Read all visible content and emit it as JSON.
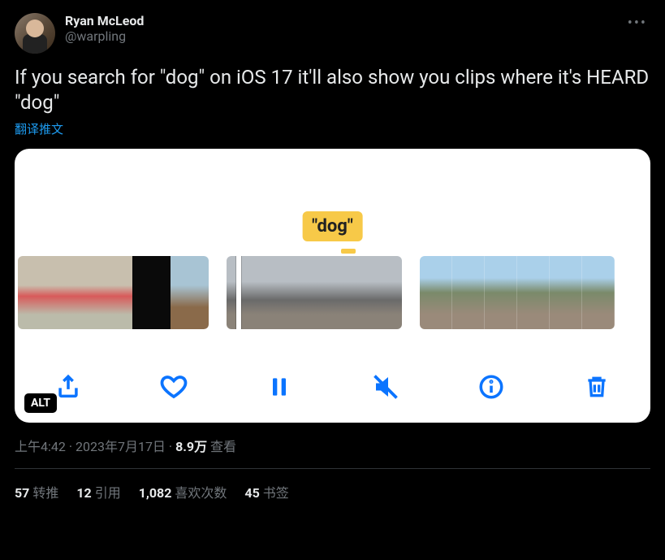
{
  "author": {
    "display_name": "Ryan McLeod",
    "handle": "@warpling"
  },
  "tweet_text": "If you search for \"dog\" on iOS 17 it'll also show you clips where it's HEARD \"dog\"",
  "translate_label": "翻译推文",
  "media": {
    "tooltip": "\"dog\"",
    "alt_badge": "ALT"
  },
  "meta": {
    "time": "上午4:42",
    "date": "2023年7月17日",
    "views_num": "8.9万",
    "views_label": "查看",
    "dot": " · "
  },
  "stats": {
    "retweets": {
      "num": "57",
      "label": "转推"
    },
    "quotes": {
      "num": "12",
      "label": "引用"
    },
    "likes": {
      "num": "1,082",
      "label": "喜欢次数"
    },
    "bookmarks": {
      "num": "45",
      "label": "书签"
    }
  }
}
